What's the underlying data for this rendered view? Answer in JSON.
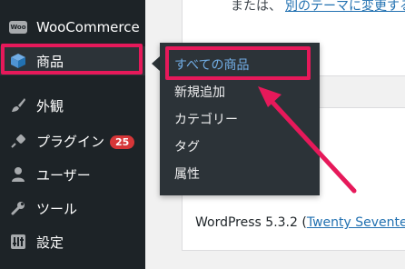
{
  "sidebar": {
    "items": [
      {
        "label": "WooCommerce",
        "icon": "woocommerce-icon"
      },
      {
        "label": "商品",
        "icon": "box-icon"
      },
      {
        "label": "外観",
        "icon": "brush-icon"
      },
      {
        "label": "プラグイン",
        "icon": "plug-icon",
        "badge": "25"
      },
      {
        "label": "ユーザー",
        "icon": "user-icon"
      },
      {
        "label": "ツール",
        "icon": "wrench-icon"
      },
      {
        "label": "設定",
        "icon": "settings-icon"
      }
    ]
  },
  "flyout": {
    "items": [
      {
        "label": "すべての商品",
        "active": true
      },
      {
        "label": "新規追加"
      },
      {
        "label": "カテゴリー"
      },
      {
        "label": "タグ"
      },
      {
        "label": "属性"
      }
    ]
  },
  "content": {
    "top_text": "または、",
    "top_link": "別のテーマに変更する",
    "wp_version_text": "WordPress 5.3.2 (",
    "wp_theme_link": "Twenty Seventeen"
  },
  "colors": {
    "sidebar_bg": "#1d2327",
    "flyout_bg": "#2c3338",
    "highlight": "#e6195a",
    "active_link": "#72aee6",
    "badge": "#d63638"
  }
}
